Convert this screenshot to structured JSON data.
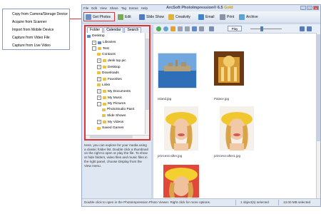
{
  "dropdown": {
    "items": [
      {
        "label": "Copy from Camera/Storage Device"
      },
      {
        "label": "Acquire from Scanner"
      },
      {
        "label": "Import from Mobile Device"
      },
      {
        "label": "Capture from Video File"
      },
      {
        "label": "Capture from Live Video"
      }
    ]
  },
  "window": {
    "menu": [
      "File",
      "Edit",
      "View",
      "Share",
      "Tag",
      "Extras",
      "Help"
    ],
    "title_prefix": "ArcSoft PhotoImpression",
    "title_version": "6.5",
    "title_gold": "Gold",
    "buttons": {
      "minimize": "_",
      "maximize": "□",
      "close": "x"
    }
  },
  "toolbar": {
    "get_photos": "Get Photos",
    "edit": "Edit",
    "slide_show": "Slide Show",
    "creativity": "Creativity",
    "email": "Email",
    "print": "Print",
    "archive": "Archive"
  },
  "tabs": [
    "Folder",
    "Calendar",
    "Search"
  ],
  "tree": [
    {
      "label": "Desktop",
      "level": 0,
      "exp": ""
    },
    {
      "label": "Libraries",
      "level": 1,
      "exp": "+"
    },
    {
      "label": "Test",
      "level": 1,
      "exp": "-"
    },
    {
      "label": "Contacts",
      "level": 2,
      "exp": ""
    },
    {
      "label": "desk top pic",
      "level": 2,
      "exp": "+"
    },
    {
      "label": "Desktop",
      "level": 2,
      "exp": "+"
    },
    {
      "label": "Downloads",
      "level": 2,
      "exp": ""
    },
    {
      "label": "Favorites",
      "level": 2,
      "exp": "+"
    },
    {
      "label": "Links",
      "level": 2,
      "exp": ""
    },
    {
      "label": "My Documents",
      "level": 2,
      "exp": "+"
    },
    {
      "label": "My Music",
      "level": 2,
      "exp": "+"
    },
    {
      "label": "My Pictures",
      "level": 2,
      "exp": "-"
    },
    {
      "label": "PhotoStudio Paint",
      "level": 3,
      "exp": ""
    },
    {
      "label": "Slide Shows",
      "level": 3,
      "exp": ""
    },
    {
      "label": "My Videos",
      "level": 2,
      "exp": "+"
    },
    {
      "label": "Saved Games",
      "level": 2,
      "exp": ""
    }
  ],
  "help_text": "Here, you can explore for your media using a classic folder list. Double click a thumbnail on the right to open or play the file. To show or hide folders, video files and music files in the right panel, choose Display from the View menu.",
  "viewbar": {
    "play": "Play"
  },
  "photos": [
    {
      "caption": "Island.jpg"
    },
    {
      "caption": "Palace.jpg"
    },
    {
      "caption": "princess-after.jpg"
    },
    {
      "caption": "princess-after1.jpg"
    },
    {
      "caption": ""
    }
  ],
  "status": {
    "hint": "Double click to open in the PhotoImpression Photo Viewer. Right click for more options.",
    "selected": "1 object(s) selected",
    "size": "13.00 MB selected"
  },
  "colors": {
    "highlight": "#dd3333",
    "accent": "#c49a10"
  }
}
